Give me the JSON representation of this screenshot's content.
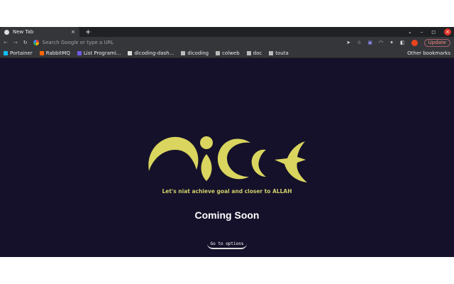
{
  "tab": {
    "title": "New Tab",
    "close": "×",
    "new": "+"
  },
  "window": {
    "chevron": "⌄",
    "min": "–",
    "max": "◻",
    "close": "×"
  },
  "omnibox": {
    "placeholder": "Search Google or type a URL"
  },
  "toolbar": {
    "update": "Update",
    "menu": "⋮"
  },
  "bookmarks": [
    {
      "label": "Portainer",
      "color": "#13bef9"
    },
    {
      "label": "RabbitMQ",
      "color": "#ff6600"
    },
    {
      "label": "List Programi...",
      "color": "#6c5ce7"
    },
    {
      "label": "dicoding-dash...",
      "color": "#ddd"
    },
    {
      "label": "dicoding",
      "color": "#bbb"
    },
    {
      "label": "colweb",
      "color": "#bbb"
    },
    {
      "label": "doc",
      "color": "#bbb"
    },
    {
      "label": "touta",
      "color": "#bbb"
    }
  ],
  "other_bookmarks": "Other bookmarks",
  "page": {
    "logo_text": "niat",
    "tagline": "Let's niat achieve goal and closer to ALLAH",
    "heading": "Coming Soon",
    "button": "Go to options"
  },
  "colors": {
    "logo": "#d9d55e",
    "bg": "#15112a"
  }
}
